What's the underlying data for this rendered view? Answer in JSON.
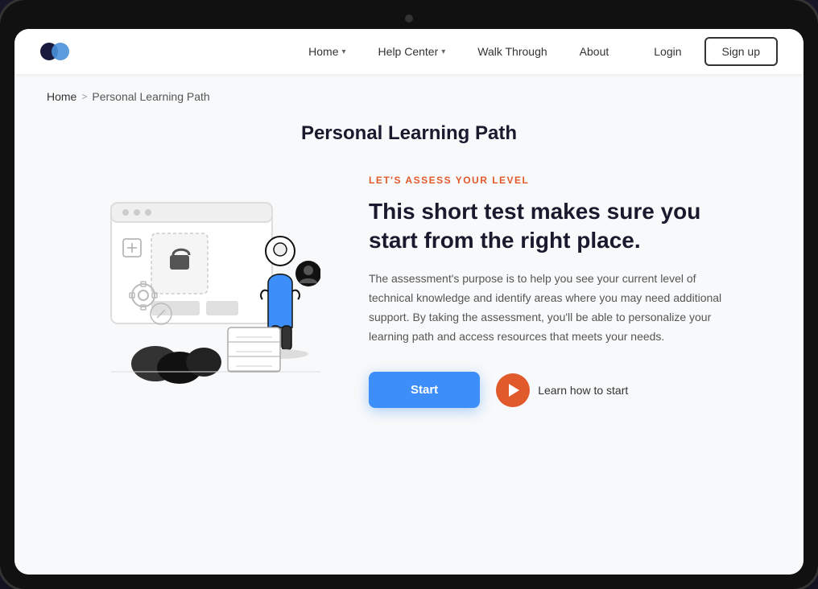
{
  "tablet": {
    "camera_aria": "tablet camera"
  },
  "navbar": {
    "logo_aria": "brand logo",
    "links": [
      {
        "id": "home",
        "label": "Home",
        "has_dropdown": true
      },
      {
        "id": "help-center",
        "label": "Help Center",
        "has_dropdown": true
      },
      {
        "id": "walk-through",
        "label": "Walk Through",
        "has_dropdown": false
      },
      {
        "id": "about",
        "label": "About",
        "has_dropdown": false
      }
    ],
    "login_label": "Login",
    "signup_label": "Sign up"
  },
  "breadcrumb": {
    "home_label": "Home",
    "separator": ">",
    "current_label": "Personal Learning Path"
  },
  "page_title": "Personal Learning Path",
  "hero": {
    "assess_label": "LET'S ASSESS YOUR LEVEL",
    "heading": "This short test makes sure you start from the right place.",
    "description": "The assessment's purpose is to help you see your current level of technical knowledge and identify areas where you may need additional support. By taking the assessment, you'll be able to personalize your learning path and access resources that meets your needs.",
    "start_button_label": "Start",
    "learn_how_label": "Learn how to start"
  },
  "colors": {
    "accent_blue": "#3d8ef8",
    "accent_orange": "#e05a2b",
    "text_dark": "#1a1a2e",
    "text_muted": "#555555"
  }
}
